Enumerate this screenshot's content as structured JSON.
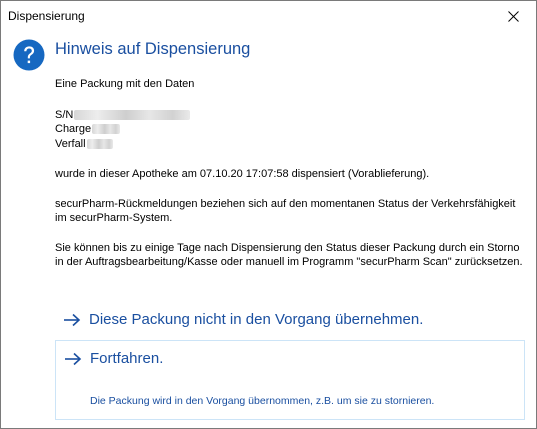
{
  "window": {
    "title": "Dispensierung"
  },
  "header": {
    "title": "Hinweis auf Dispensierung"
  },
  "body": {
    "intro": "Eine Packung mit den Daten",
    "fields": [
      {
        "label": "S/N"
      },
      {
        "label": "Charge"
      },
      {
        "label": "Verfall"
      }
    ],
    "dispensed": "wurde in dieser Apotheke am 07.10.20 17:07:58 dispensiert (Vorablieferung).",
    "info": "securPharm-Rückmeldungen beziehen sich auf den momentanen Status der Verkehrsfähigkeit im securPharm-System.",
    "instructions": "Sie können bis zu einige Tage nach Dispensierung den Status dieser Packung durch ein Storno in der Auftragsbearbeitung/Kasse oder manuell im Programm \"securPharm Scan\" zurücksetzen."
  },
  "commands": {
    "reject_label": "Diese Packung nicht in den Vorgang übernehmen.",
    "continue_label": "Fortfahren.",
    "continue_note": "Die Packung wird in den Vorgang übernommen, z.B. um sie zu stornieren."
  },
  "colors": {
    "accent": "#1a4fa0",
    "link_border": "#cce4f7",
    "help_icon": "#1668c1"
  },
  "icons": {
    "help": "question-icon",
    "close": "close-icon",
    "arrow": "arrow-right-icon"
  }
}
